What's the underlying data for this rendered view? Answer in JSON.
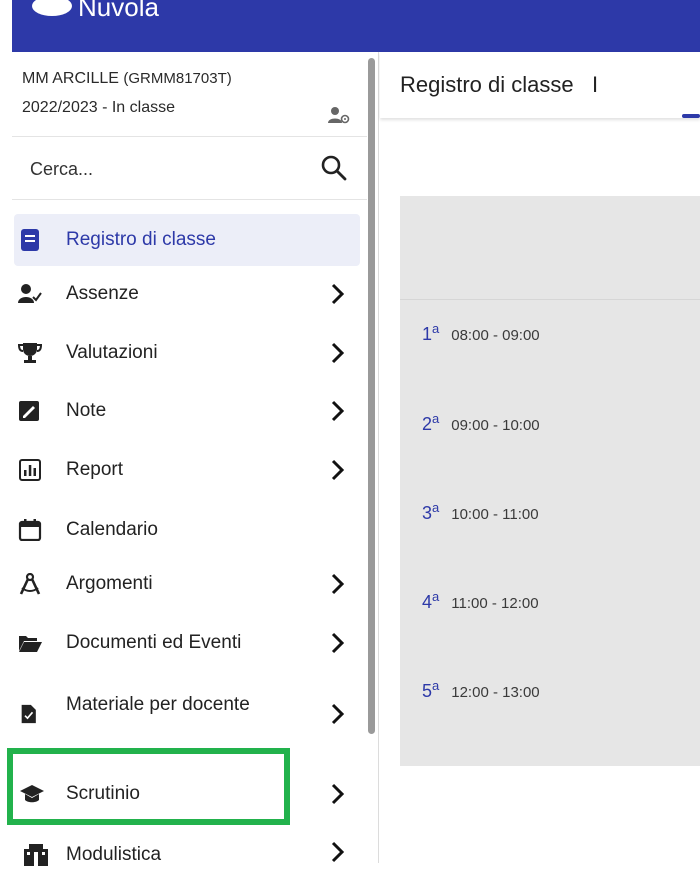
{
  "app": {
    "brand": "Nuvola"
  },
  "sidebar": {
    "school_name": "MM ARCILLE",
    "school_code": "(GRMM81703T)",
    "year_label": "2022/2023 - In classe",
    "search_placeholder": "Cerca...",
    "items": [
      {
        "label": "Registro di classe",
        "icon": "book-icon",
        "active": true,
        "has_chevron": false
      },
      {
        "label": "Assenze",
        "icon": "user-check-icon",
        "active": false,
        "has_chevron": true
      },
      {
        "label": "Valutazioni",
        "icon": "trophy-icon",
        "active": false,
        "has_chevron": true
      },
      {
        "label": "Note",
        "icon": "note-icon",
        "active": false,
        "has_chevron": true
      },
      {
        "label": "Report",
        "icon": "chart-report-icon",
        "active": false,
        "has_chevron": true
      },
      {
        "label": "Calendario",
        "icon": "calendar-icon",
        "active": false,
        "has_chevron": false
      },
      {
        "label": "Argomenti",
        "icon": "compass-icon",
        "active": false,
        "has_chevron": true
      },
      {
        "label": "Documenti ed Eventi",
        "icon": "folder-open-icon",
        "active": false,
        "has_chevron": true
      },
      {
        "label": "Materiale per docente",
        "icon": "file-check-icon",
        "active": false,
        "has_chevron": true
      },
      {
        "label": "Scrutinio",
        "icon": "graduation-cap-icon",
        "active": false,
        "has_chevron": true
      },
      {
        "label": "Modulistica",
        "icon": "building-icon",
        "active": false,
        "has_chevron": true
      }
    ]
  },
  "main": {
    "title": "Registro di classe",
    "separator": "I",
    "slots": [
      {
        "num": "1",
        "sup": "a",
        "time": "08:00 - 09:00"
      },
      {
        "num": "2",
        "sup": "a",
        "time": "09:00 - 10:00"
      },
      {
        "num": "3",
        "sup": "a",
        "time": "10:00 - 11:00"
      },
      {
        "num": "4",
        "sup": "a",
        "time": "11:00 - 12:00"
      },
      {
        "num": "5",
        "sup": "a",
        "time": "12:00 - 13:00"
      }
    ]
  },
  "colors": {
    "brand": "#2d39a8",
    "highlight": "#22b24c",
    "active_bg": "#eceef8",
    "panel": "#e6e6e6"
  }
}
